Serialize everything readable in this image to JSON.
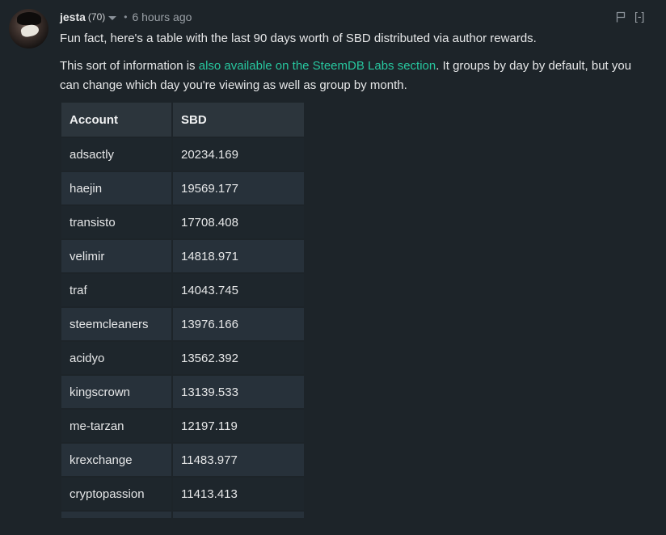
{
  "comment": {
    "author": "jesta",
    "reputation": "(70)",
    "separator": "•",
    "timestamp": "6 hours ago",
    "collapse_label": "[-]",
    "paragraph1": "Fun fact, here's a table with the last 90 days worth of SBD distributed via author rewards.",
    "paragraph2_before": "This sort of information is ",
    "paragraph2_link": "also available on the SteemDB Labs section",
    "paragraph2_after": ". It groups by day by default, but you can change which day you're viewing as well as group by month."
  },
  "table": {
    "headers": [
      "Account",
      "SBD"
    ],
    "rows": [
      {
        "account": "adsactly",
        "sbd": "20234.169"
      },
      {
        "account": "haejin",
        "sbd": "19569.177"
      },
      {
        "account": "transisto",
        "sbd": "17708.408"
      },
      {
        "account": "velimir",
        "sbd": "14818.971"
      },
      {
        "account": "traf",
        "sbd": "14043.745"
      },
      {
        "account": "steemcleaners",
        "sbd": "13976.166"
      },
      {
        "account": "acidyo",
        "sbd": "13562.392"
      },
      {
        "account": "kingscrown",
        "sbd": "13139.533"
      },
      {
        "account": "me-tarzan",
        "sbd": "12197.119"
      },
      {
        "account": "krexchange",
        "sbd": "11483.977"
      },
      {
        "account": "cryptopassion",
        "sbd": "11413.413"
      }
    ]
  },
  "colors": {
    "background": "#1d2429",
    "link": "#27c79f",
    "header_cell": "#2c353c",
    "row_even": "#27313a",
    "row_odd": "#1e262c"
  }
}
